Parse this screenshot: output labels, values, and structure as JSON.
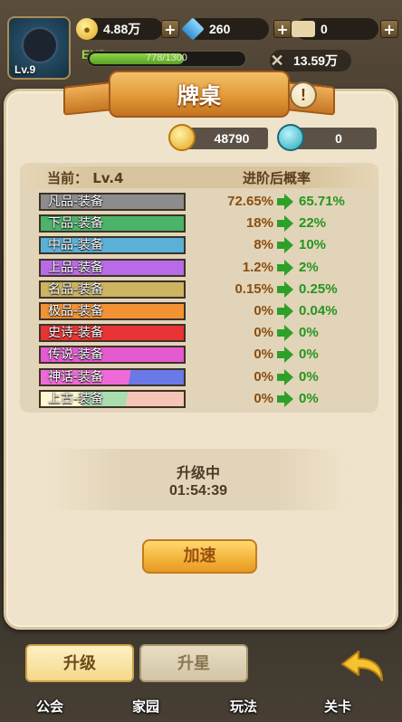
{
  "hud": {
    "level": "Lv.9",
    "gold": "4.88万",
    "diamond": "260",
    "ticket": "0",
    "exp_label": "EXP",
    "exp_progress": "778/1300",
    "power": "13.59万"
  },
  "panel": {
    "title": "牌桌",
    "info_icon": "!",
    "gold_amount": "48790",
    "gem_amount": "0"
  },
  "table": {
    "header_current": "当前：  Lv.4",
    "header_after": "进阶后概率",
    "rows": [
      {
        "label": "凡品-装备",
        "from": "72.65%",
        "to": "65.71%",
        "color": "#8c8c8c"
      },
      {
        "label": "下品-装备",
        "from": "18%",
        "to": "22%",
        "color": "#4bb36a"
      },
      {
        "label": "中品-装备",
        "from": "8%",
        "to": "10%",
        "color": "#5bb0d8"
      },
      {
        "label": "上品-装备",
        "from": "1.2%",
        "to": "2%",
        "color": "#b96ae6"
      },
      {
        "label": "名品-装备",
        "from": "0.15%",
        "to": "0.25%",
        "color": "#cdb461"
      },
      {
        "label": "极品-装备",
        "from": "0%",
        "to": "0.04%",
        "color": "#f39235"
      },
      {
        "label": "史诗-装备",
        "from": "0%",
        "to": "0%",
        "color": "#e83434"
      },
      {
        "label": "传说-装备",
        "from": "0%",
        "to": "0%",
        "color": "#e55ad1"
      },
      {
        "label": "神话-装备",
        "from": "0%",
        "to": "0%",
        "color": "#ef6ad8"
      },
      {
        "label": "上古-装备",
        "from": "0%",
        "to": "0%",
        "color": "#f5c6b8"
      }
    ]
  },
  "status": {
    "title": "升级中",
    "time": "01:54:39"
  },
  "buttons": {
    "speed": "加速",
    "upgrade": "升级",
    "star": "升星"
  },
  "nav": {
    "items": [
      "公会",
      "家园",
      "玩法",
      "关卡"
    ]
  }
}
